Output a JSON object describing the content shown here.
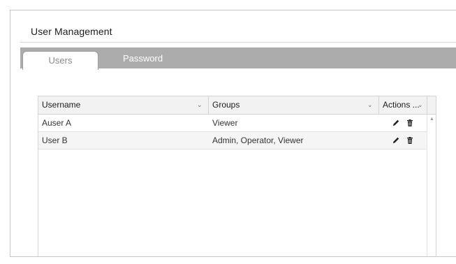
{
  "page": {
    "title": "User Management"
  },
  "tabs": [
    {
      "label": "Users",
      "active": true
    },
    {
      "label": "Password",
      "active": false
    }
  ],
  "table": {
    "columns": [
      {
        "label": "Username"
      },
      {
        "label": "Groups"
      },
      {
        "label": "Actions ..."
      }
    ],
    "rows": [
      {
        "username": "Auser A",
        "groups": "Viewer"
      },
      {
        "username": "User B",
        "groups": "Admin, Operator, Viewer"
      }
    ]
  },
  "icons": {
    "sort": "chevron-down-icon",
    "edit": "pencil-icon",
    "delete": "trash-icon",
    "scroll_up": "caret-up-icon"
  },
  "colors": {
    "tab_bar": "#acacac",
    "header_bg": "#f2f2f2",
    "row_alt": "#f5f5f5"
  }
}
